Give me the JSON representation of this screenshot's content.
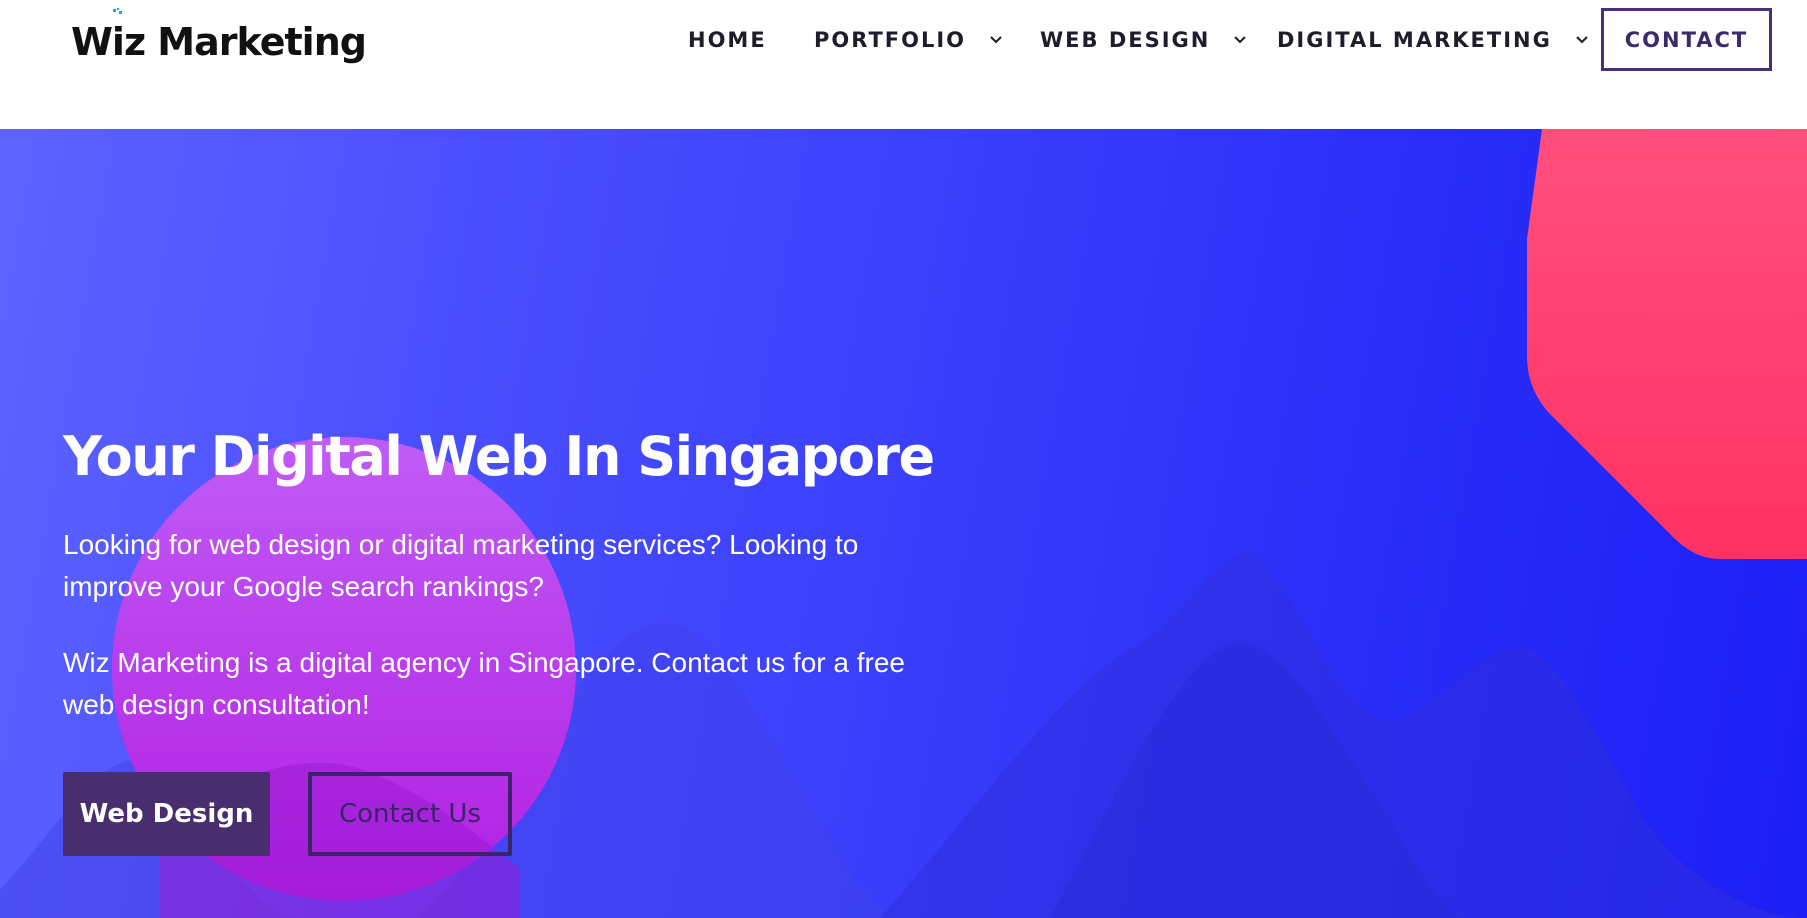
{
  "brand": {
    "name": "Wiz Marketing",
    "name_prefix": "W",
    "name_i": "i",
    "name_suffix": "z Marketing"
  },
  "nav": {
    "items": [
      {
        "label": "HOME",
        "has_dropdown": false
      },
      {
        "label": "PORTFOLIO",
        "has_dropdown": true
      },
      {
        "label": "WEB DESIGN",
        "has_dropdown": true
      },
      {
        "label": "DIGITAL MARKETING",
        "has_dropdown": true
      }
    ],
    "contact_label": "CONTACT"
  },
  "hero": {
    "title": "Your Digital Web In Singapore",
    "paragraph1": "Looking for web design or digital marketing services? Looking to improve your Google search rankings?",
    "paragraph2": "Wiz Marketing is a digital agency in Singapore.  Contact us for a free web design consultation!",
    "primary_button": "Web Design",
    "secondary_button": "Contact Us"
  },
  "colors": {
    "accent_purple": "#482d6f",
    "hero_gradient_start": "#5d63ff",
    "hero_gradient_end": "#1c1ff5",
    "magenta_circle": "#c03cf0",
    "pink_shape": "#ff4477"
  },
  "icons": {
    "dropdown": "chevron-down-icon",
    "logo_mark": "sparkle-icon"
  }
}
